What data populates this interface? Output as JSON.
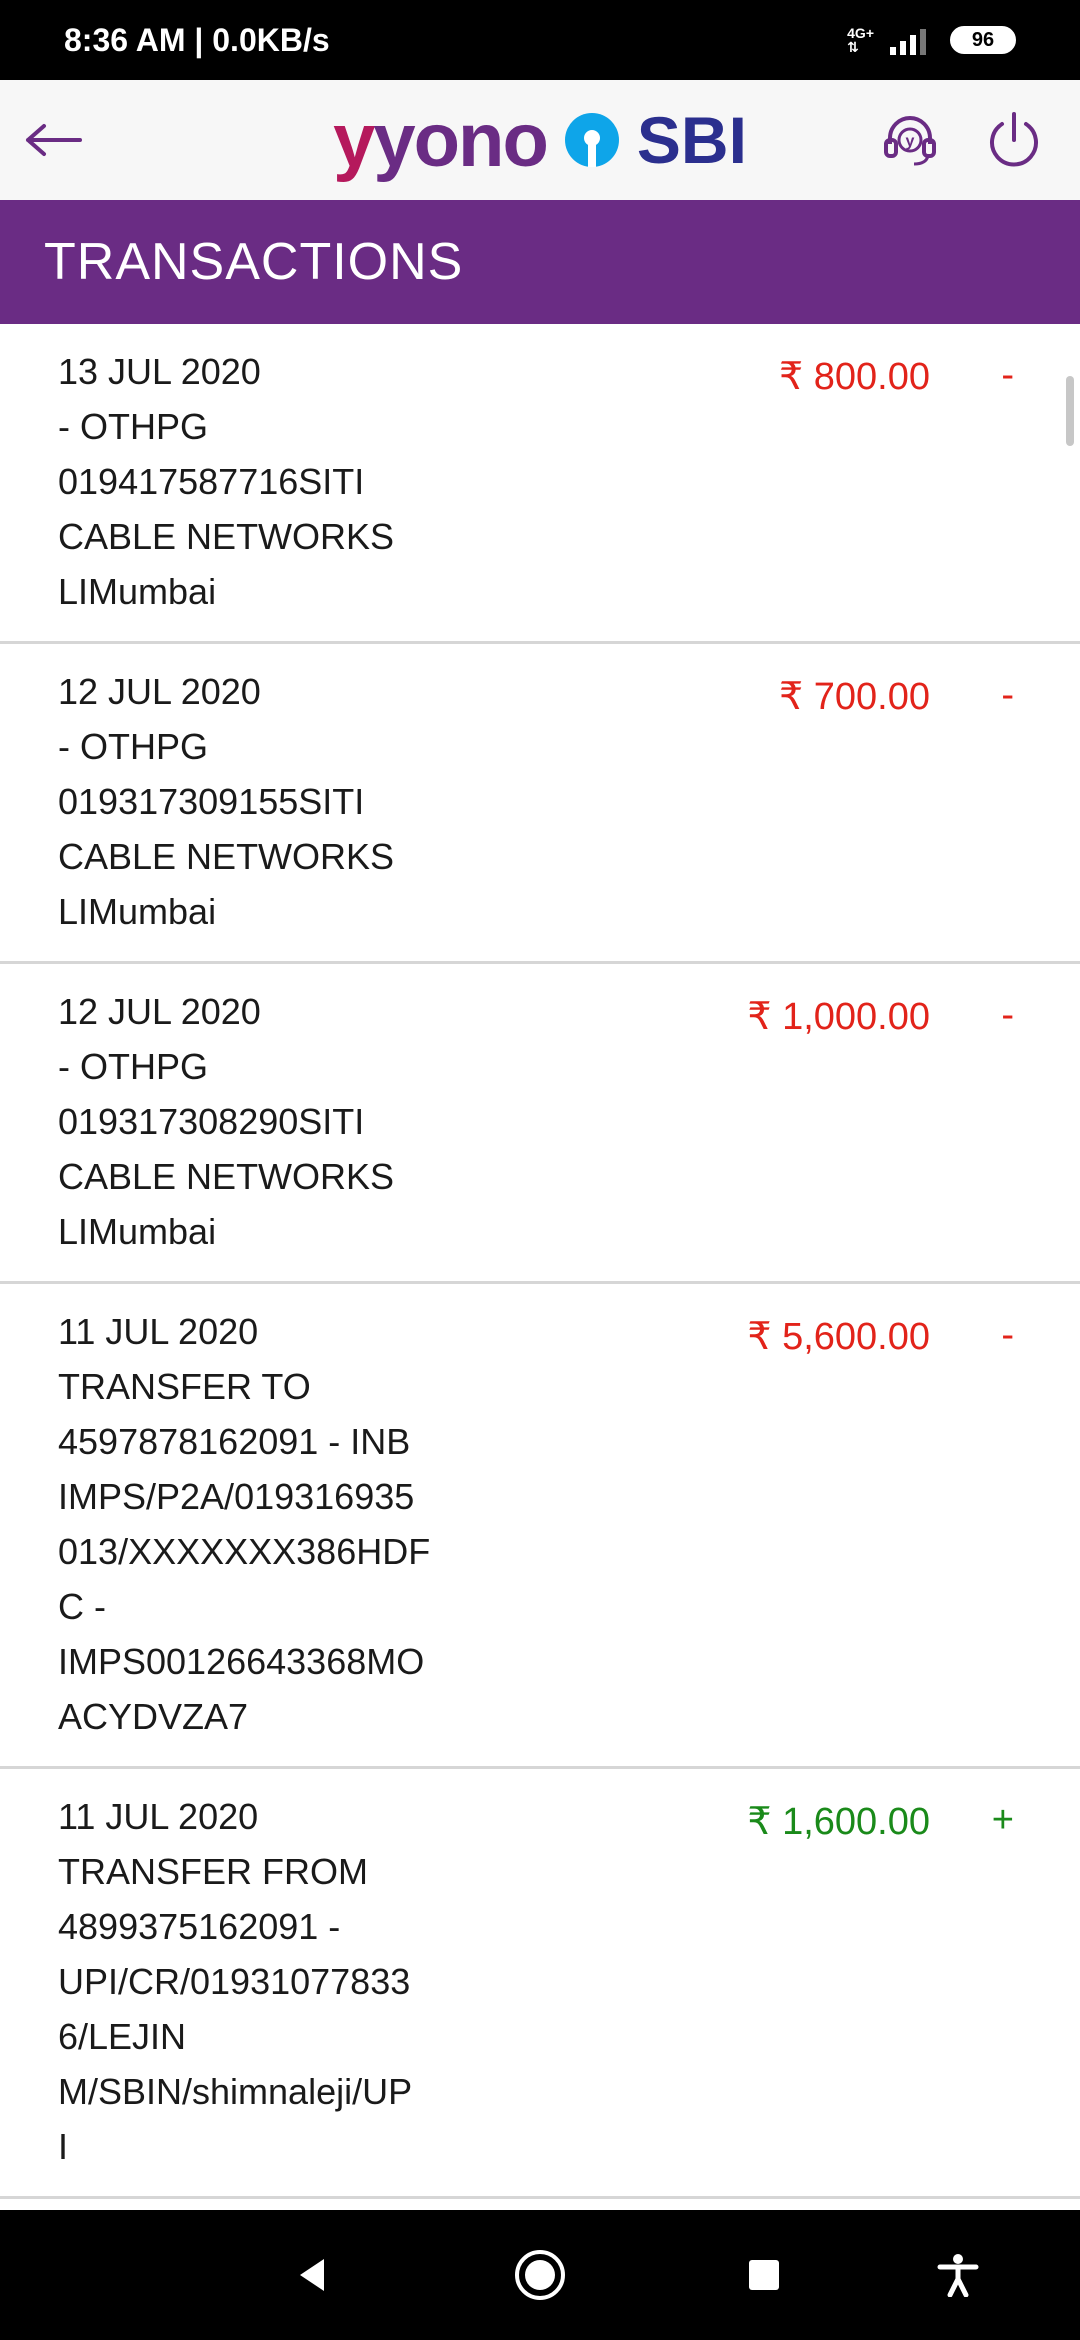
{
  "status_bar": {
    "time": "8:36 AM | 0.0KB/s",
    "network": "4G+",
    "battery": "96"
  },
  "app_bar": {
    "logo_yono": "yono",
    "logo_sbi": "SBI"
  },
  "section": {
    "title": "TRANSACTIONS"
  },
  "transactions": [
    {
      "date": "13 JUL 2020",
      "description": "- OTHPG\n019417587716SITI\nCABLE NETWORKS\nLIMumbai",
      "amount": "₹ 800.00",
      "sign": "-",
      "type": "debit"
    },
    {
      "date": "12 JUL 2020",
      "description": "- OTHPG\n019317309155SITI\nCABLE NETWORKS\nLIMumbai",
      "amount": "₹ 700.00",
      "sign": "-",
      "type": "debit"
    },
    {
      "date": "12 JUL 2020",
      "description": "- OTHPG\n019317308290SITI\nCABLE NETWORKS\nLIMumbai",
      "amount": "₹ 1,000.00",
      "sign": "-",
      "type": "debit"
    },
    {
      "date": "11 JUL 2020",
      "description": "TRANSFER TO\n4597878162091 - INB\nIMPS/P2A/019316935\n013/XXXXXXX386HDF\nC -\nIMPS00126643368MO\nACYDVZA7",
      "amount": "₹ 5,600.00",
      "sign": "-",
      "type": "debit"
    },
    {
      "date": "11 JUL 2020",
      "description": "TRANSFER FROM\n4899375162091 -\nUPI/CR/01931077833\n6/LEJIN\nM/SBIN/shimnaleji/UP\nI",
      "amount": "₹ 1,600.00",
      "sign": "+",
      "type": "credit"
    }
  ],
  "colors": {
    "header_purple": "#6a2c84",
    "debit": "#e2231a",
    "credit": "#1a8a1a",
    "yono_magenta": "#b5195c",
    "sbi_blue": "#2b2f8e"
  }
}
